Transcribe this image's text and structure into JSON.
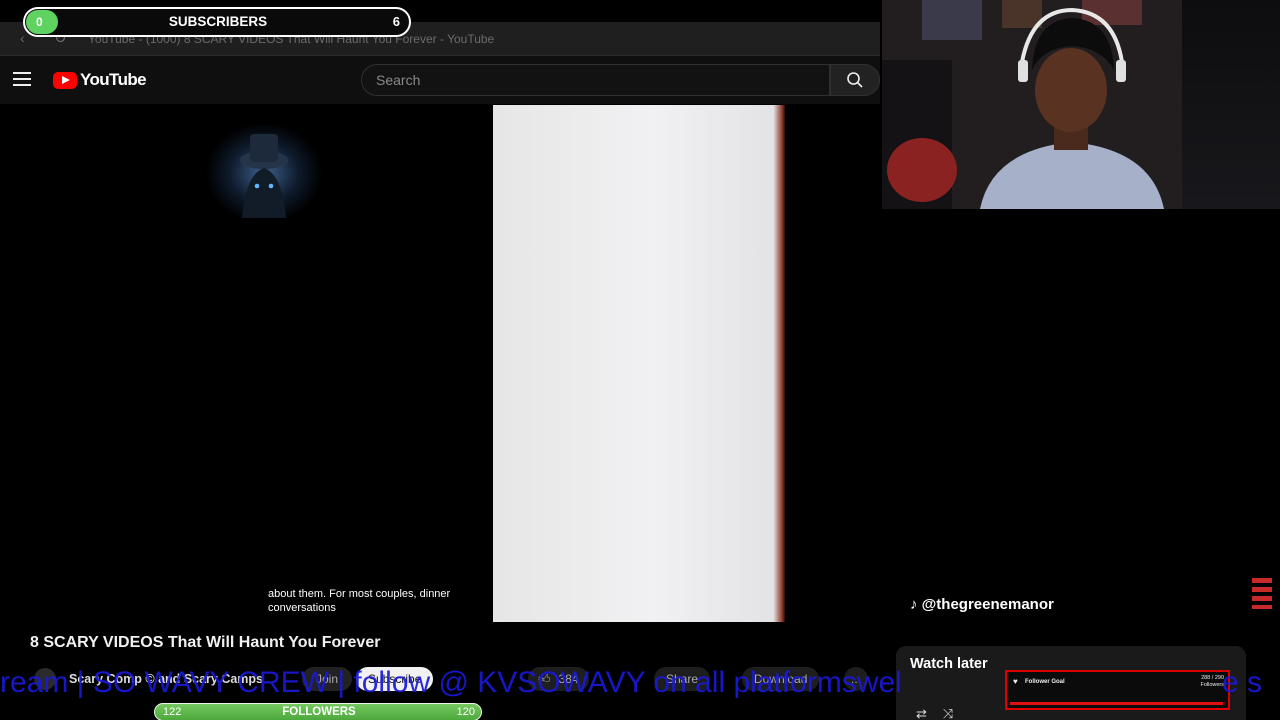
{
  "browser": {
    "tab_title": "YouTube - (1000) 8 SCARY VIDEOS That Will Haunt You Forever - YouTube"
  },
  "youtube": {
    "logo_text": "YouTube",
    "search_placeholder": "Search"
  },
  "player": {
    "caption_line1": "about them. For most couples, dinner",
    "caption_line2": "conversations"
  },
  "video": {
    "title": "8 SCARY VIDEOS That Will Haunt You Forever",
    "channel": "Scary Comp © and Scary Camps",
    "join_label": "Join",
    "subscribe_label": "Subscribe",
    "likes": "384",
    "share_label": "Share",
    "download_label": "Download",
    "more_label": "..."
  },
  "overlay": {
    "subscribers_label": "SUBSCRIBERS",
    "subscribers_count": "0",
    "subscribers_goal": "6",
    "followers_label": "FOLLOWERS",
    "followers_count": "122",
    "followers_goal": "120",
    "tiktok_handle": "@thegreenemanor",
    "ticker_text": "ream | SO WAVY CREW | follow @ KVSOWAVY on all platformswel",
    "ticker_tail": "e s",
    "follower_goal_label": "Follower Goal",
    "follower_goal_count": "288 / 290",
    "follower_goal_unit": "Followers",
    "follower_goal_progress": 0.993
  },
  "sidebar": {
    "watch_later_title": "Watch later"
  },
  "colors": {
    "accent_red": "#ff0000",
    "sub_green": "#5fd35f",
    "ticker_blue": "#1919d8"
  }
}
